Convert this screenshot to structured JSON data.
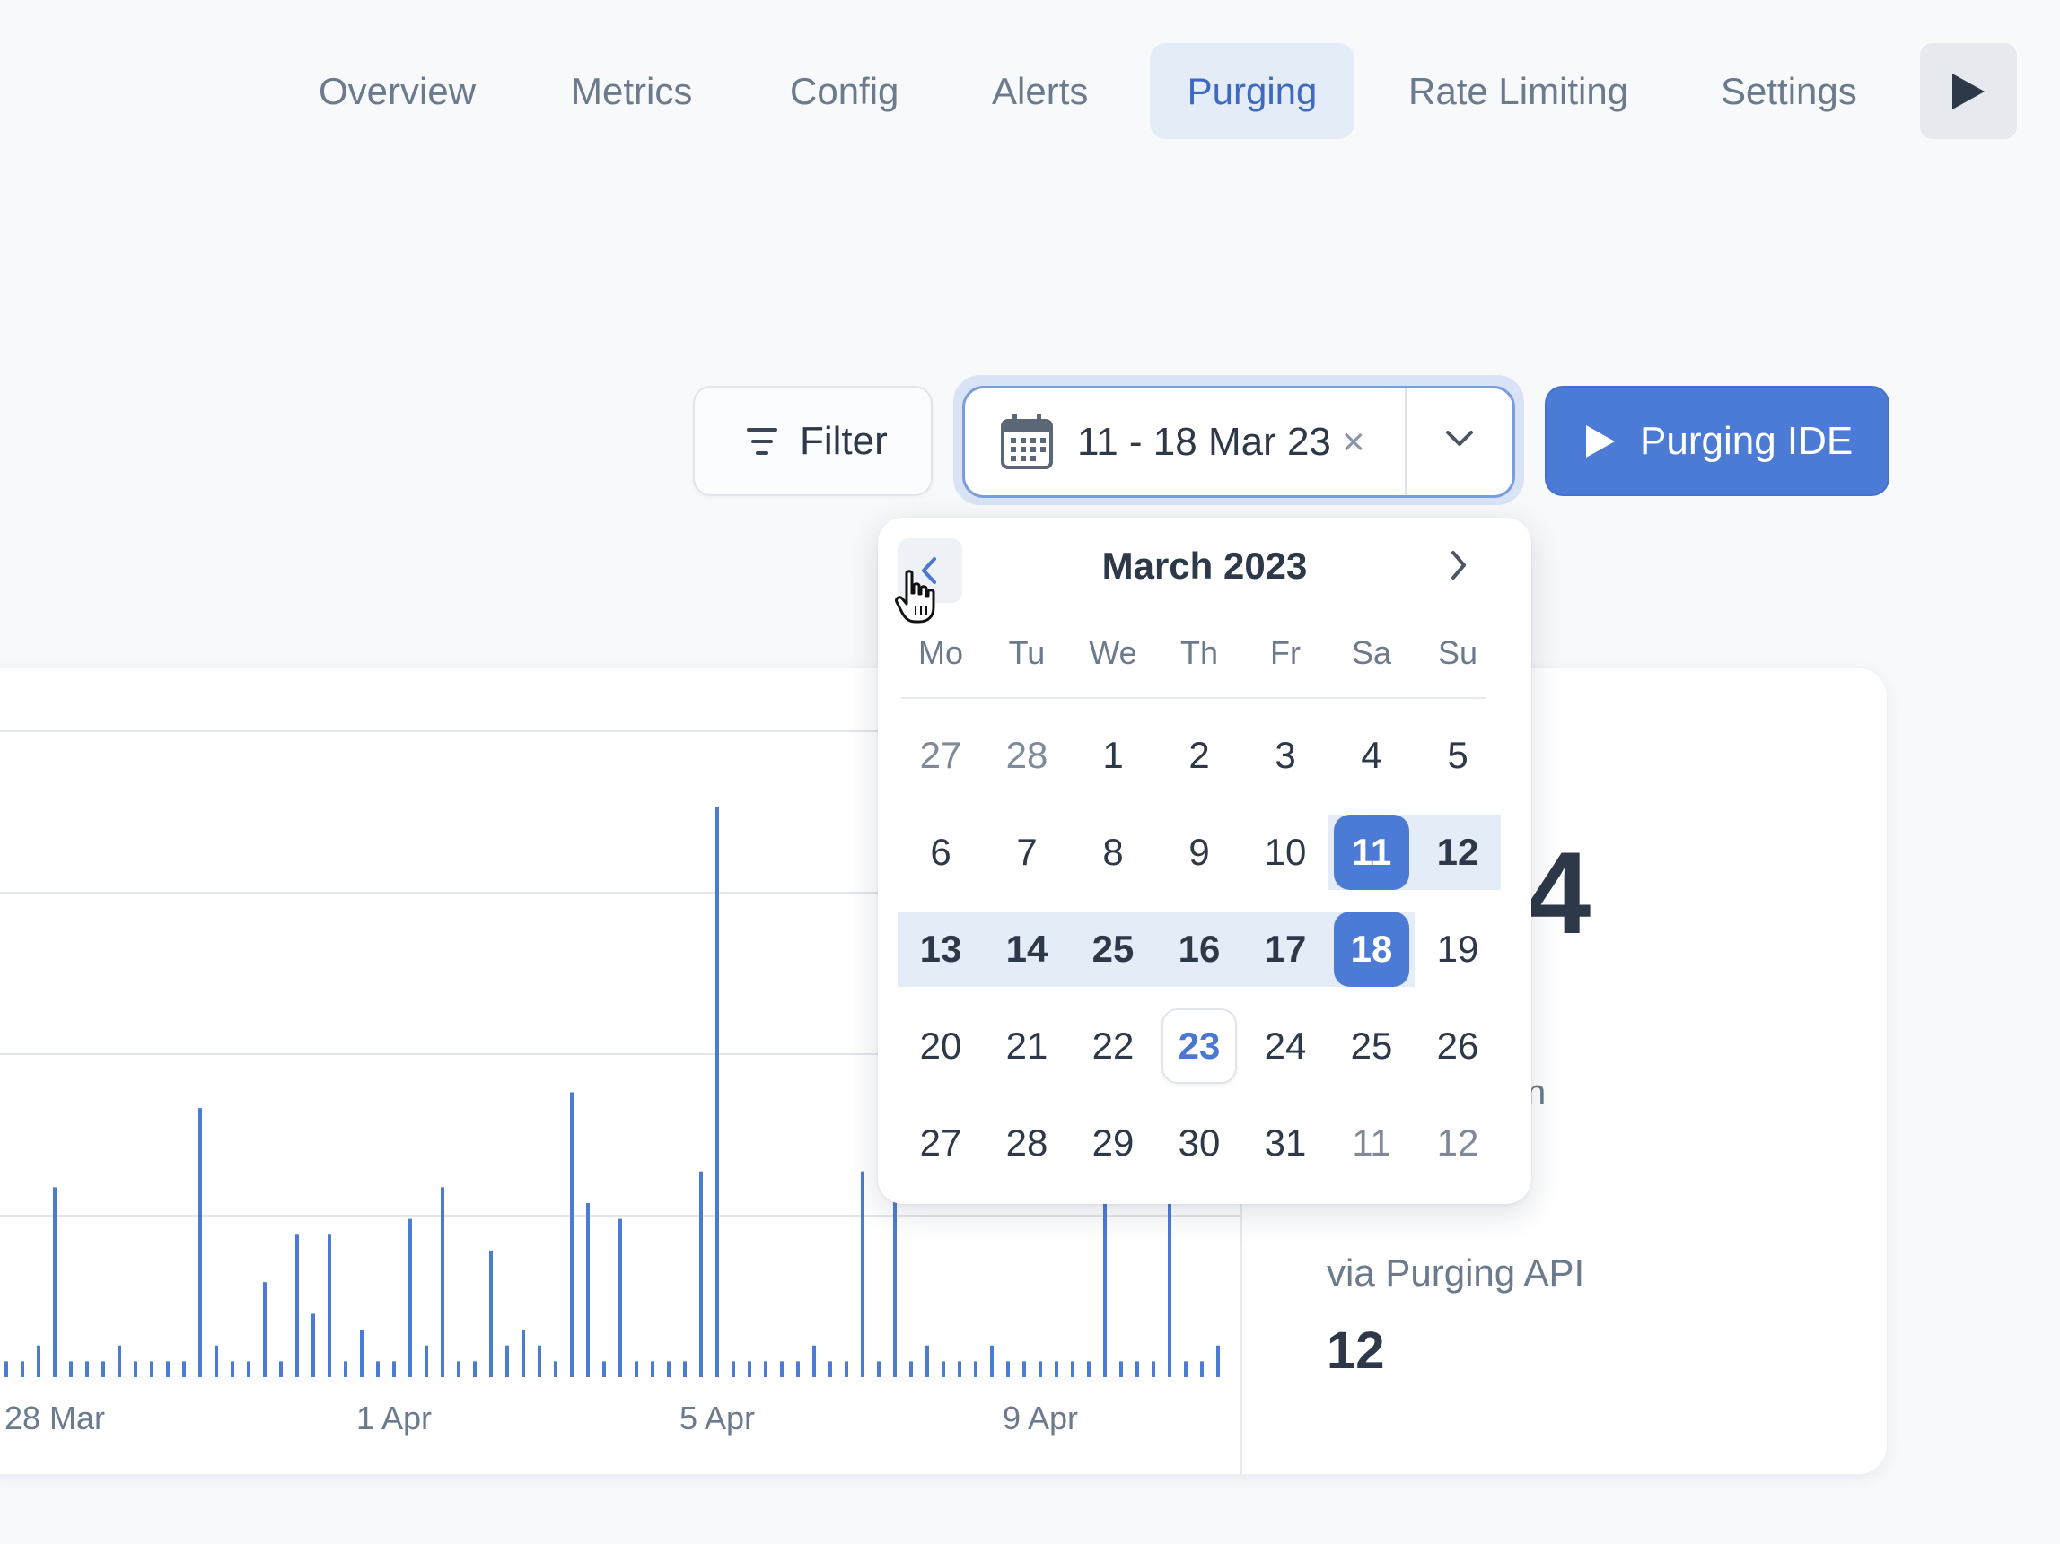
{
  "nav": {
    "items": [
      {
        "label": "Overview",
        "active": false
      },
      {
        "label": "Metrics",
        "active": false
      },
      {
        "label": "Config",
        "active": false
      },
      {
        "label": "Alerts",
        "active": false
      },
      {
        "label": "Purging",
        "active": true
      },
      {
        "label": "Rate Limiting",
        "active": false
      },
      {
        "label": "Settings",
        "active": false
      }
    ],
    "play_icon": "play-icon"
  },
  "toolbar": {
    "filter_label": "Filter",
    "filter_icon": "filter-lines-icon",
    "date_range": "11 - 18 Mar 23",
    "calendar_icon": "calendar-icon",
    "clear_icon": "×",
    "dropdown_icon": "chevron-down-icon",
    "ide_label": "Purging IDE",
    "ide_icon": "play-icon"
  },
  "calendar": {
    "title": "March 2023",
    "weekdays": [
      "Mo",
      "Tu",
      "We",
      "Th",
      "Fr",
      "Sa",
      "Su"
    ],
    "weeks": [
      [
        "27",
        "28",
        "1",
        "2",
        "3",
        "4",
        "5"
      ],
      [
        "6",
        "7",
        "8",
        "9",
        "10",
        "11",
        "12"
      ],
      [
        "13",
        "14",
        "25",
        "16",
        "17",
        "18",
        "19"
      ],
      [
        "20",
        "21",
        "22",
        "23",
        "24",
        "25",
        "26"
      ],
      [
        "27",
        "28",
        "29",
        "30",
        "31",
        "11",
        "12"
      ]
    ],
    "muted": [
      [
        0,
        0
      ],
      [
        0,
        1
      ],
      [
        4,
        5
      ],
      [
        4,
        6
      ]
    ],
    "range_start": [
      1,
      5
    ],
    "range_end": [
      2,
      5
    ],
    "in_range": [
      [
        1,
        6
      ],
      [
        2,
        0
      ],
      [
        2,
        1
      ],
      [
        2,
        2
      ],
      [
        2,
        3
      ],
      [
        2,
        4
      ]
    ],
    "today": [
      3,
      3
    ]
  },
  "stats": {
    "big_value_fragment": "4",
    "label_fragment": "n",
    "api_label": "via Purging API",
    "api_value": "12"
  },
  "colors": {
    "accent": "#4c7bd6",
    "bar": "#4c7bd6",
    "active_bg": "#e4ecf8"
  },
  "chart_data": {
    "type": "bar",
    "x_tick_labels": [
      "28 Mar",
      "1 Apr",
      "5 Apr",
      "9 Apr"
    ],
    "x_tick_index": [
      3,
      24,
      44,
      64
    ],
    "grid": true,
    "values": [
      1,
      1,
      2,
      12,
      1,
      1,
      1,
      2,
      1,
      1,
      1,
      1,
      17,
      2,
      1,
      1,
      6,
      1,
      9,
      4,
      9,
      1,
      3,
      1,
      1,
      10,
      2,
      12,
      1,
      1,
      8,
      2,
      3,
      2,
      1,
      18,
      11,
      1,
      10,
      1,
      1,
      1,
      1,
      13,
      36,
      1,
      1,
      1,
      1,
      1,
      2,
      1,
      1,
      13,
      1,
      13,
      1,
      2,
      1,
      1,
      1,
      2,
      1,
      1,
      1,
      1,
      1,
      1,
      12,
      1,
      1,
      1,
      12,
      1,
      1,
      2
    ]
  }
}
